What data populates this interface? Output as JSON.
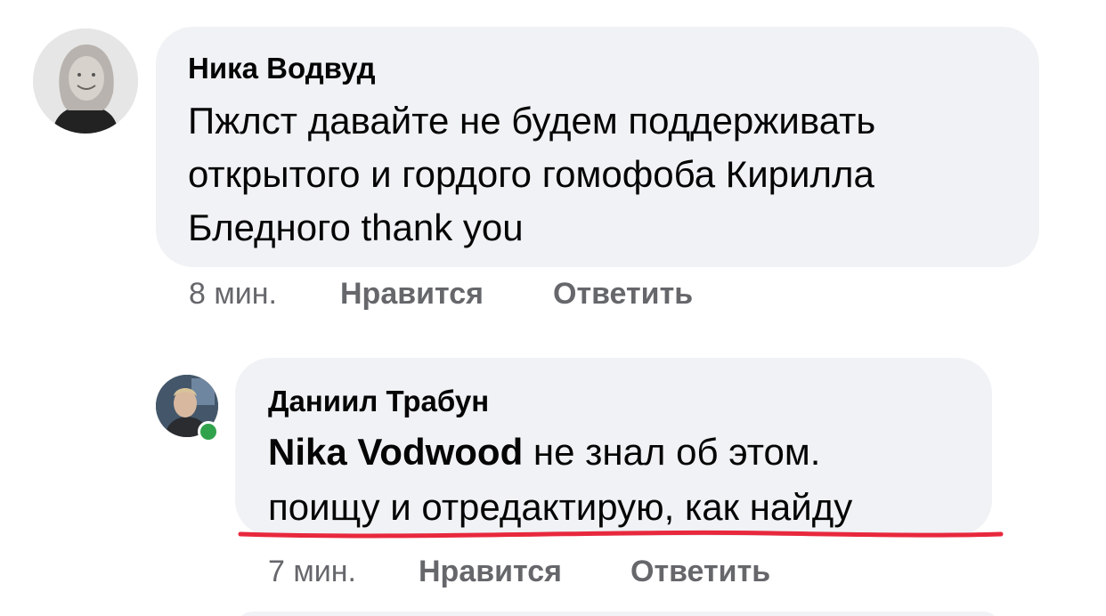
{
  "comments": [
    {
      "author": "Ника Водвуд",
      "text_lines": [
        "Пжлст давайте не будем поддерживать",
        "открытого и гордого гомофоба Кирилла",
        "Бледного thank you"
      ],
      "time": "8 мин.",
      "like_label": "Нравится",
      "reply_label": "Ответить"
    },
    {
      "author": "Даниил Трабун",
      "mention": "Nika Vodwood",
      "text_line1_rest": " не знал об этом.",
      "text_line2": "поищу и отредактирую, как найду",
      "time": "7 мин.",
      "like_label": "Нравится",
      "reply_label": "Ответить",
      "online": true
    }
  ],
  "colors": {
    "bubble": "#f0f2f5",
    "meta_text": "#65676b",
    "online_dot": "#31a24c",
    "underline": "#e8283d"
  }
}
